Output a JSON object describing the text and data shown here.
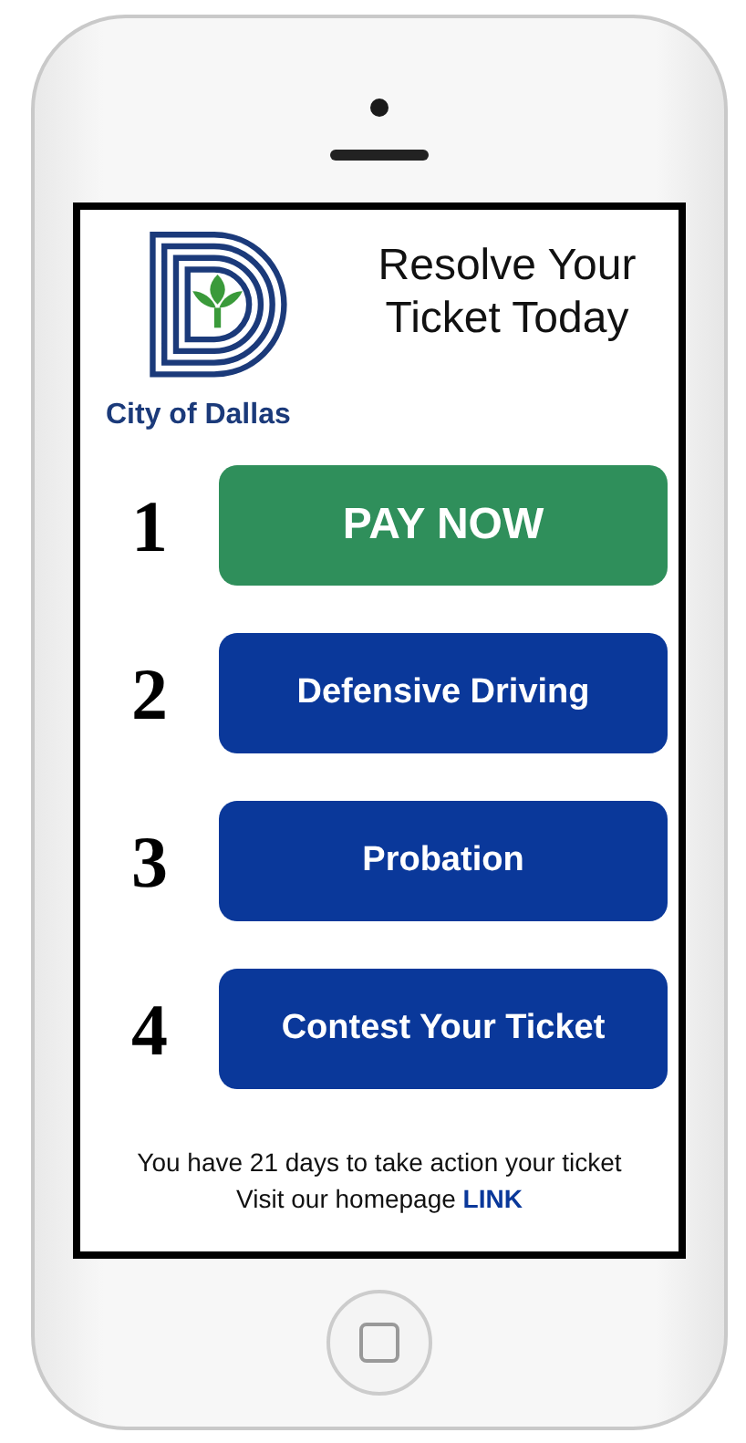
{
  "header": {
    "logo_caption": "City of Dallas",
    "title": "Resolve Your Ticket Today"
  },
  "steps": [
    {
      "number": "1",
      "label": "PAY NOW",
      "kind": "primary"
    },
    {
      "number": "2",
      "label": "Defensive Driving",
      "kind": "secondary"
    },
    {
      "number": "3",
      "label": "Probation",
      "kind": "secondary"
    },
    {
      "number": "4",
      "label": "Contest Your Ticket",
      "kind": "secondary"
    }
  ],
  "footer": {
    "notice": "You have 21 days to take action your ticket",
    "homepage_text": "Visit our homepage",
    "link": "LINK"
  }
}
